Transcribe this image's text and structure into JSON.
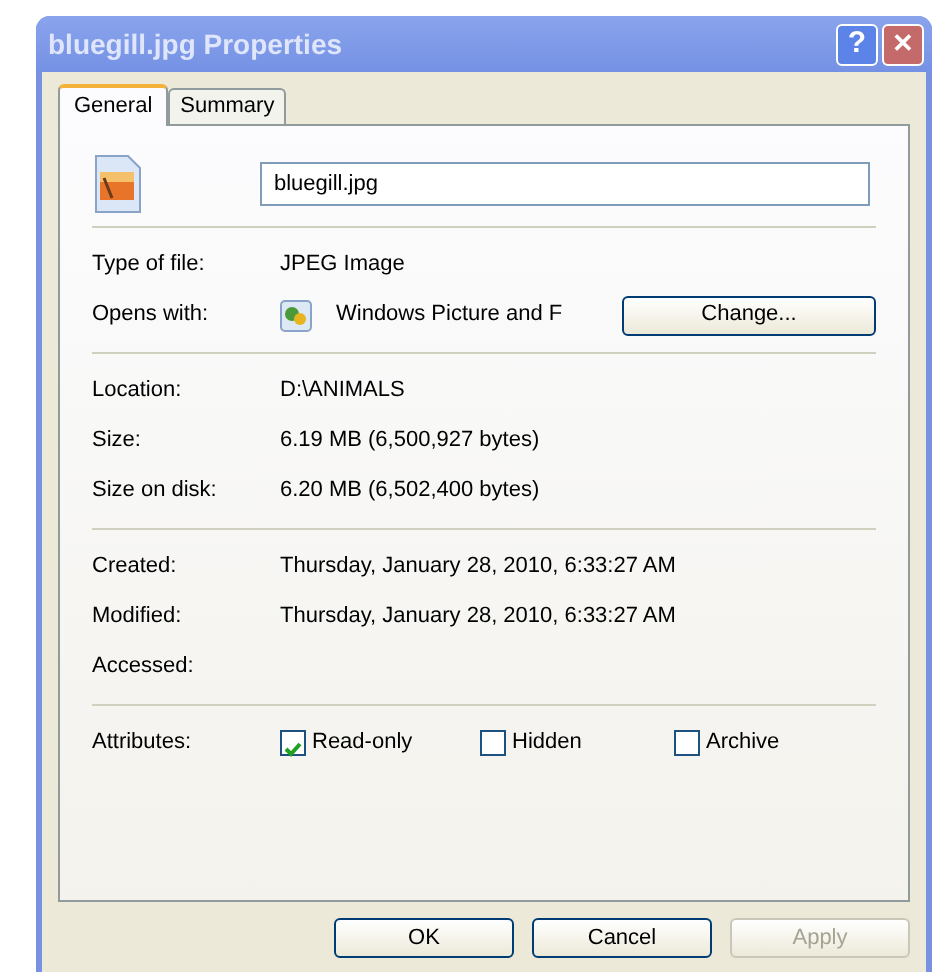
{
  "window": {
    "title": "bluegill.jpg Properties",
    "controls": [
      {
        "kind": "help",
        "label": "?"
      },
      {
        "kind": "close",
        "label": "✕"
      }
    ]
  },
  "tabs": [
    {
      "label": "General",
      "selected": true
    },
    {
      "label": "Summary",
      "selected": false
    }
  ],
  "file_name": "bluegill.jpg",
  "groups": [
    {
      "rows": [
        {
          "kind": "text",
          "label": "Type of file:",
          "value": "JPEG Image"
        },
        {
          "kind": "app",
          "label": "Opens with:",
          "value": "Windows Picture and F",
          "button": "Change..."
        }
      ]
    },
    {
      "rows": [
        {
          "kind": "text",
          "label": "Location:",
          "value": "D:\\ANIMALS"
        },
        {
          "kind": "text",
          "label": "Size:",
          "value": "6.19 MB (6,500,927 bytes)"
        },
        {
          "kind": "text",
          "label": "Size on disk:",
          "value": "6.20 MB (6,502,400 bytes)"
        }
      ]
    },
    {
      "rows": [
        {
          "kind": "text",
          "label": "Created:",
          "value": "Thursday, January 28, 2010, 6:33:27 AM"
        },
        {
          "kind": "text",
          "label": "Modified:",
          "value": "Thursday, January 28, 2010, 6:33:27 AM"
        },
        {
          "kind": "text",
          "label": "Accessed:"
        }
      ]
    }
  ],
  "attributes": {
    "label": "Attributes:",
    "items": [
      {
        "label": "Read-only",
        "checked": true
      },
      {
        "label": "Hidden",
        "checked": false
      },
      {
        "label": "Archive",
        "checked": false
      }
    ]
  },
  "buttons": [
    {
      "label": "OK",
      "disabled": false
    },
    {
      "label": "Cancel",
      "disabled": false
    },
    {
      "label": "Apply",
      "disabled": true
    }
  ]
}
